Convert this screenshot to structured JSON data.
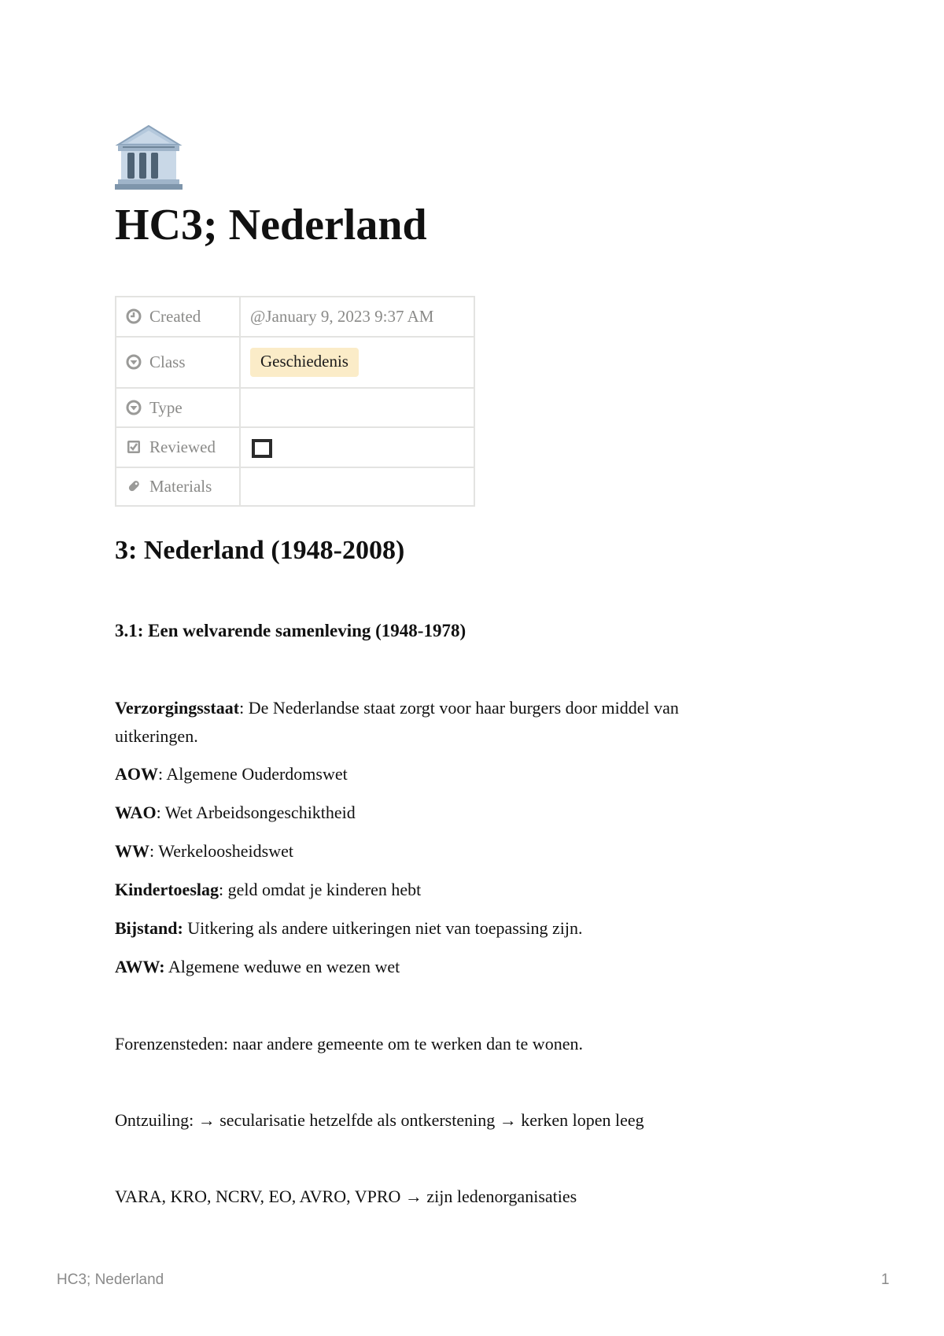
{
  "page": {
    "icon": "classical-building-icon",
    "title": "HC3; Nederland"
  },
  "properties": [
    {
      "key": "Created",
      "icon": "clock-icon",
      "value": "@January 9, 2023 9:37 AM"
    },
    {
      "key": "Class",
      "icon": "select-icon",
      "tag": "Geschiedenis",
      "tag_color": "#fbecc8"
    },
    {
      "key": "Type",
      "icon": "select-icon",
      "value": ""
    },
    {
      "key": "Reviewed",
      "icon": "checkbox-icon",
      "checked": false
    },
    {
      "key": "Materials",
      "icon": "paperclip-icon",
      "value": ""
    }
  ],
  "content": {
    "heading": "3: Nederland (1948-2008)",
    "subheading": "3.1: Een welvarende samenleving (1948-1978)",
    "terms": [
      {
        "term": "Verzorgingsstaat",
        "sep": ": ",
        "definition": "De Nederlandse staat zorgt voor haar burgers door middel van uitkeringen."
      },
      {
        "term": "AOW",
        "sep": ": ",
        "definition": "Algemene Ouderdomswet"
      },
      {
        "term": "WAO",
        "sep": ": ",
        "definition": "Wet Arbeidsongeschiktheid"
      },
      {
        "term": "WW",
        "sep": ": ",
        "definition": "Werkeloosheidswet"
      },
      {
        "term": "Kindertoeslag",
        "sep": ": ",
        "definition": "geld omdat je kinderen hebt"
      },
      {
        "term": "Bijstand:",
        "sep": " ",
        "definition": "Uitkering als andere uitkeringen niet van toepassing zijn."
      },
      {
        "term": "AWW:",
        "sep": " ",
        "definition": "Algemene weduwe en wezen wet"
      }
    ],
    "forenzensteden": "Forenzensteden: naar andere gemeente om te werken dan te wonen.",
    "ontzuiling": "Ontzuiling: → secularisatie hetzelfde als ontkerstening → kerken lopen leeg",
    "omroepen": "VARA, KRO, NCRV, EO, AVRO, VPRO → zijn ledenorganisaties"
  },
  "footer": {
    "title": "HC3; Nederland",
    "page_number": "1"
  }
}
